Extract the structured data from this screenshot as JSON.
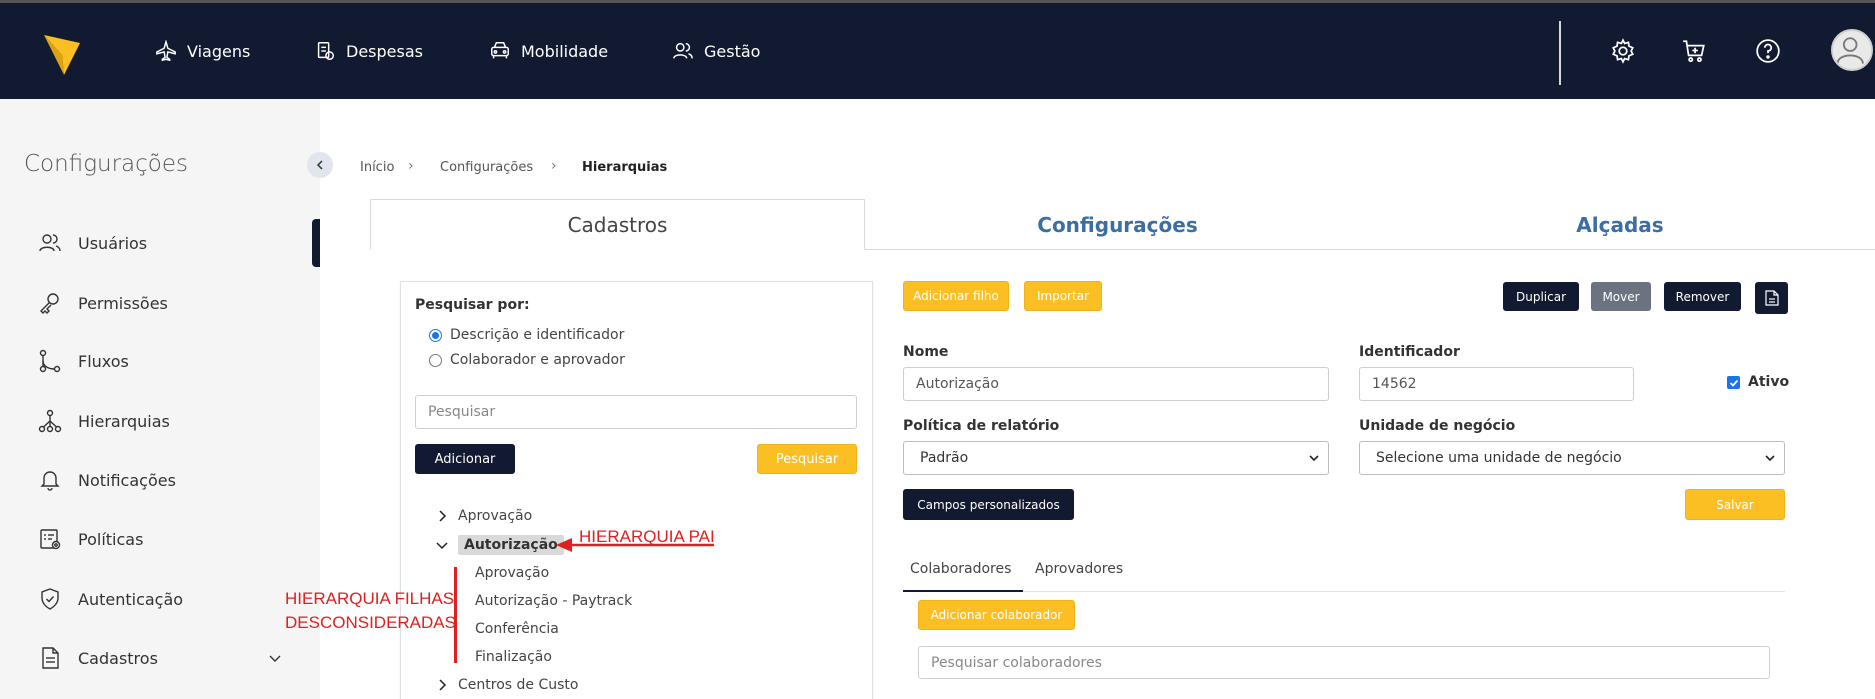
{
  "topnav": {
    "items": [
      {
        "label": "Viagens",
        "icon": "plane-icon"
      },
      {
        "label": "Despesas",
        "icon": "receipt-icon"
      },
      {
        "label": "Mobilidade",
        "icon": "car-icon"
      },
      {
        "label": "Gestão",
        "icon": "users-icon"
      }
    ],
    "right_icons": [
      "gear-icon",
      "cart-icon",
      "help-icon",
      "avatar"
    ]
  },
  "sidebar": {
    "title": "Configurações",
    "items": [
      {
        "label": "Usuários",
        "icon": "users-icon"
      },
      {
        "label": "Permissões",
        "icon": "key-icon"
      },
      {
        "label": "Fluxos",
        "icon": "flow-icon"
      },
      {
        "label": "Hierarquias",
        "icon": "hierarchy-icon"
      },
      {
        "label": "Notificações",
        "icon": "bell-icon"
      },
      {
        "label": "Políticas",
        "icon": "policy-icon"
      },
      {
        "label": "Autenticação",
        "icon": "shield-icon"
      },
      {
        "label": "Cadastros",
        "icon": "document-icon"
      }
    ]
  },
  "breadcrumb": {
    "items": [
      "Início",
      "Configurações",
      "Hierarquias"
    ]
  },
  "tabs": [
    "Cadastros",
    "Configurações",
    "Alçadas"
  ],
  "search": {
    "title": "Pesquisar por:",
    "options": [
      "Descrição e identificador",
      "Colaborador e aprovador"
    ],
    "selected": 0,
    "placeholder": "Pesquisar",
    "add_label": "Adicionar",
    "search_label": "Pesquisar"
  },
  "tree": {
    "items": [
      {
        "label": "Aprovação",
        "level": 0,
        "expanded": false
      },
      {
        "label": "Autorização",
        "level": 0,
        "expanded": true,
        "selected": true
      },
      {
        "label": "Aprovação",
        "level": 1
      },
      {
        "label": "Autorização - Paytrack",
        "level": 1
      },
      {
        "label": "Conferência",
        "level": 1
      },
      {
        "label": "Finalização",
        "level": 1
      },
      {
        "label": "Centros de Custo",
        "level": 0,
        "expanded": false
      }
    ]
  },
  "annotations": {
    "parent": "HIERARQUIA PAI",
    "children_line1": "HIERARQUIA FILHAS",
    "children_line2": "DESCONSIDERADAS",
    "color": "#e02020"
  },
  "actions": {
    "add_child": "Adicionar filho",
    "import": "Importar",
    "duplicate": "Duplicar",
    "move": "Mover",
    "remove": "Remover"
  },
  "form": {
    "name_label": "Nome",
    "name_value": "Autorização",
    "id_label": "Identificador",
    "id_value": "14562",
    "active_label": "Ativo",
    "active_checked": true,
    "policy_label": "Política de relatório",
    "policy_value": "Padrão",
    "business_unit_label": "Unidade de negócio",
    "business_unit_value": "Selecione uma unidade de negócio",
    "custom_fields": "Campos personalizados",
    "save": "Salvar"
  },
  "subtabs": [
    "Colaboradores",
    "Aprovadores"
  ],
  "collaborators": {
    "add_label": "Adicionar colaborador",
    "search_placeholder": "Pesquisar colaboradores"
  },
  "colors": {
    "navy": "#121a32",
    "yellow": "#fbbf24",
    "link_blue": "#3a6ea5"
  }
}
